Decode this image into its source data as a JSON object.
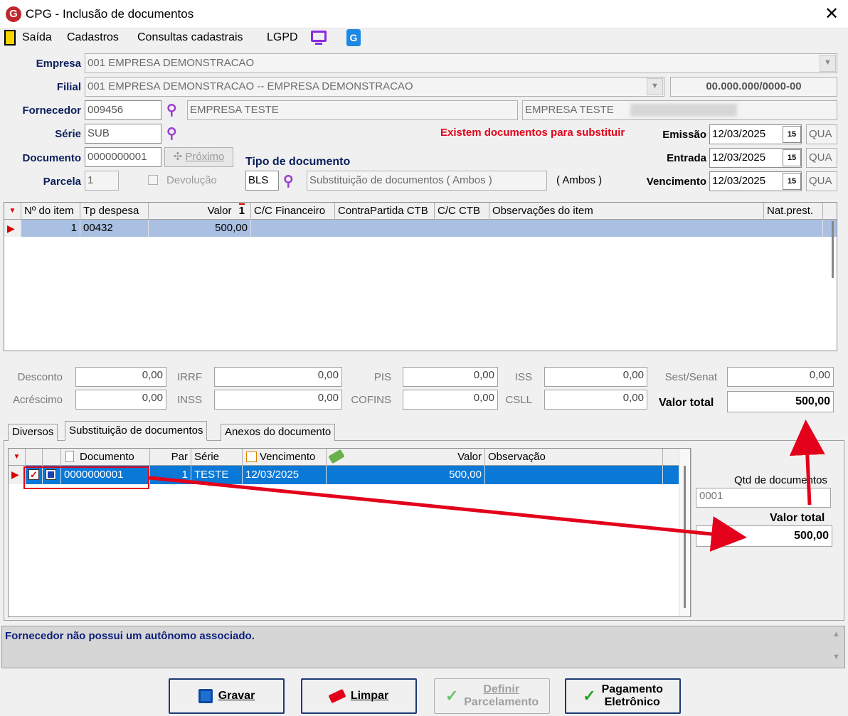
{
  "window": {
    "title": "CPG - Inclusão de documentos",
    "close": "✕"
  },
  "menu": {
    "items": [
      "Saída",
      "Cadastros",
      "Consultas cadastrais",
      "LGPD"
    ]
  },
  "form": {
    "empresa_label": "Empresa",
    "empresa_value": "001 EMPRESA DEMONSTRACAO",
    "filial_label": "Filial",
    "filial_value": "001 EMPRESA DEMONSTRACAO -- EMPRESA DEMONSTRACAO",
    "cnpj": "00.000.000/0000-00",
    "fornecedor_label": "Fornecedor",
    "fornecedor_code": "009456",
    "fornecedor_name": "EMPRESA TESTE",
    "fornecedor_name2": "EMPRESA TESTE",
    "serie_label": "Série",
    "serie_value": "SUB",
    "documento_label": "Documento",
    "documento_value": "0000000001",
    "proximo": "Próximo",
    "tipo_label": "Tipo de documento",
    "parcela_label": "Parcela",
    "parcela_value": "1",
    "devolucao": "Devolução",
    "tipo_code": "BLS",
    "tipo_desc": "Substituição de documentos ( Ambos )",
    "tipo_ambos": "( Ambos )",
    "warning": "Existem documentos para substituir",
    "emissao_label": "Emissão",
    "emissao_value": "12/03/2025",
    "emissao_day": "QUA",
    "entrada_label": "Entrada",
    "entrada_value": "12/03/2025",
    "entrada_day": "QUA",
    "vencimento_label": "Vencimento",
    "vencimento_value": "12/03/2025",
    "vencimento_day": "QUA",
    "cal_icon": "15"
  },
  "items_grid": {
    "headers": [
      "Nº do item",
      "Tp despesa",
      "Valor",
      "C/C Financeiro",
      "ContraPartida CTB",
      "C/C CTB",
      "Observações do item",
      "Nat.prest."
    ],
    "sort_marker": "1",
    "row": {
      "item": "1",
      "tp": "00432",
      "valor": "500,00"
    }
  },
  "totals": {
    "desconto_label": "Desconto",
    "desconto": "0,00",
    "acrescimo_label": "Acréscimo",
    "acrescimo": "0,00",
    "irrf_label": "IRRF",
    "irrf": "0,00",
    "inss_label": "INSS",
    "inss": "0,00",
    "pis_label": "PIS",
    "pis": "0,00",
    "cofins_label": "COFINS",
    "cofins": "0,00",
    "iss_label": "ISS",
    "iss": "0,00",
    "csll_label": "CSLL",
    "csll": "0,00",
    "sest_label": "Sest/Senat",
    "sest": "0,00",
    "total_label": "Valor total",
    "total": "500,00"
  },
  "tabs": [
    "Diversos",
    "Substituição de documentos",
    "Anexos do documento"
  ],
  "sub_grid": {
    "headers": [
      "Documento",
      "Par",
      "Série",
      "Vencimento",
      "Valor",
      "Observação"
    ],
    "row": {
      "documento": "0000000001",
      "par": "1",
      "serie": "TESTE",
      "vencimento": "12/03/2025",
      "valor": "500,00"
    }
  },
  "side": {
    "qtd_label": "Qtd de documentos",
    "qtd_value": "0001",
    "total_label": "Valor total",
    "total_value": "500,00"
  },
  "status": {
    "message": "Fornecedor não possui um autônomo associado."
  },
  "buttons": {
    "gravar": "Gravar",
    "limpar": "Limpar",
    "definir1": "Definir",
    "definir2": "Parcelamento",
    "pagamento1": "Pagamento",
    "pagamento2": "Eletrônico"
  }
}
